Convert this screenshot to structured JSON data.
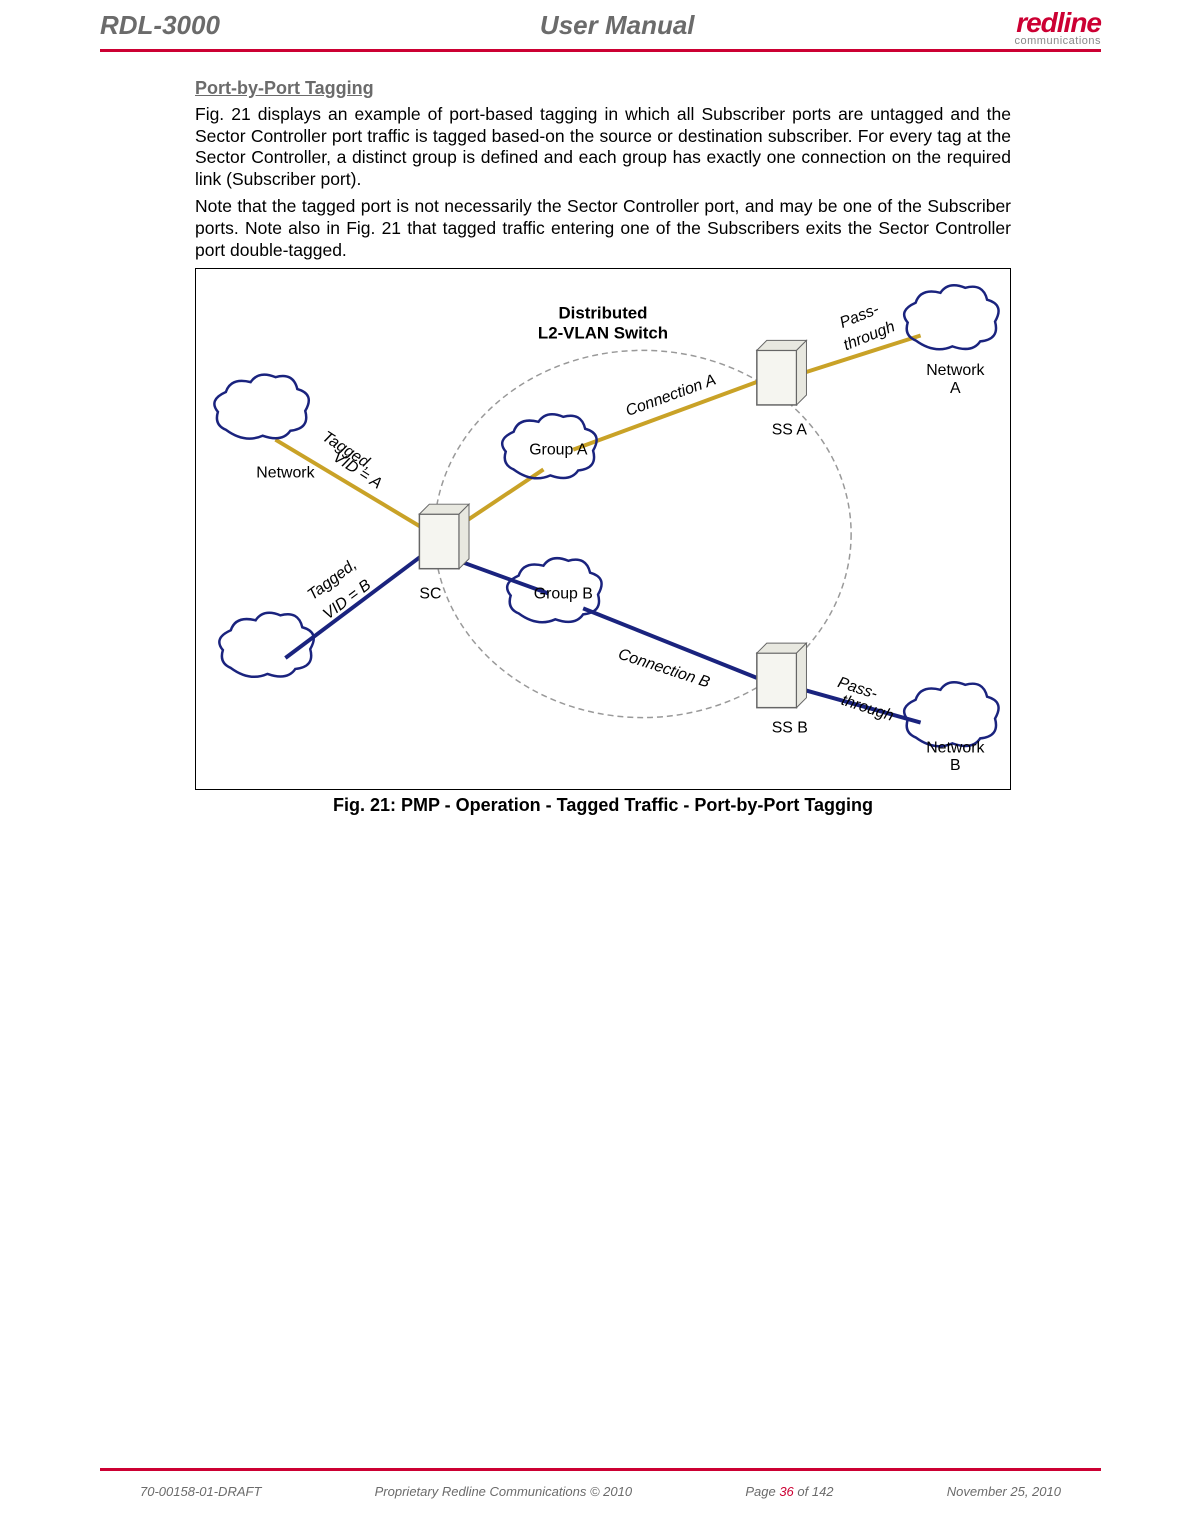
{
  "header": {
    "doc_id": "RDL-3000",
    "doc_title": "User Manual",
    "logo_main": "redline",
    "logo_sub": "communications"
  },
  "content": {
    "section_heading": "Port-by-Port Tagging",
    "para1": "Fig. 21 displays an example of port-based tagging in which all Subscriber ports are untagged and the Sector Controller port traffic is tagged based-on the source or destination subscriber. For every tag at the Sector Controller, a distinct group is defined and each group has exactly one connection on the required link (Subscriber port).",
    "para2": "Note that the tagged port is not necessarily the Sector Controller port, and may be one of the Subscriber ports. Note also in Fig. 21 that tagged traffic entering one of the Subscribers exits the Sector Controller port double-tagged.",
    "fig_caption": "Fig. 21: PMP - Operation - Tagged Traffic - Port-by-Port Tagging"
  },
  "diagram": {
    "title1": "Distributed",
    "title2": "L2-VLAN Switch",
    "network_left": "Network",
    "tagged_a": "Tagged,",
    "vid_a": "VID = A",
    "tagged_b": "Tagged,",
    "vid_b": "VID = B",
    "sc": "SC",
    "group_a": "Group A",
    "group_b": "Group B",
    "conn_a": "Connection A",
    "conn_b": "Connection B",
    "ss_a": "SS A",
    "ss_b": "SS B",
    "pass_a": "Pass-",
    "through_a": "through",
    "pass_b": "Pass-",
    "through_b": "through",
    "net_a1": "Network",
    "net_a2": "A",
    "net_b1": "Network",
    "net_b2": "B"
  },
  "footer": {
    "left": "70-00158-01-DRAFT",
    "center": "Proprietary Redline Communications © 2010",
    "page_pre": "Page ",
    "page_cur": "36",
    "page_post": " of 142",
    "date": "November 25, 2010"
  }
}
